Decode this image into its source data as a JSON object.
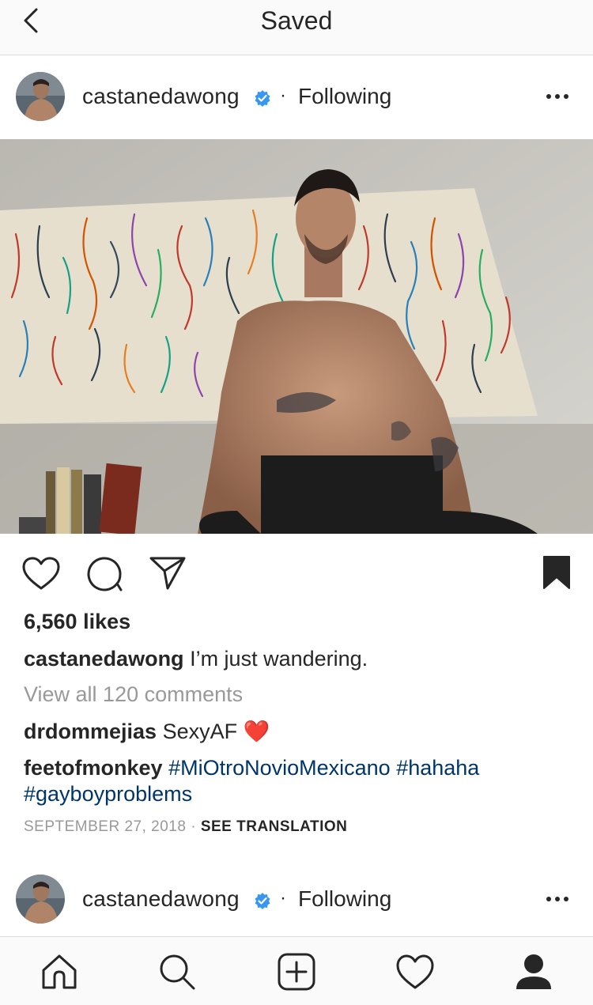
{
  "header": {
    "title": "Saved",
    "back_icon": "chevron-left-icon"
  },
  "post": {
    "username": "castanedawong",
    "verified": true,
    "follow_separator": "·",
    "follow_status": "Following",
    "likes": "6,560 likes",
    "caption": {
      "username": "castanedawong",
      "text": " I’m just wandering."
    },
    "view_comments": "View all 120 comments",
    "comments": [
      {
        "username": "drdommejias",
        "text": " SexyAF ",
        "emoji": "❤️"
      },
      {
        "username": "feetofmonkey",
        "hashtags": [
          "#MiOtroNovioMexicano",
          "#hahaha",
          "#gayboyproblems"
        ]
      }
    ],
    "date": "SEPTEMBER 27, 2018",
    "meta_separator": " · ",
    "see_translation": "SEE TRANSLATION",
    "actions": [
      "heart-icon",
      "comment-icon",
      "share-icon",
      "bookmark-icon"
    ]
  },
  "next_post": {
    "username": "castanedawong",
    "verified": true,
    "follow_separator": "·",
    "follow_status": "Following"
  },
  "bottom_nav": [
    "home-icon",
    "search-icon",
    "add-post-icon",
    "activity-heart-icon",
    "profile-icon"
  ],
  "colors": {
    "text": "#262626",
    "muted": "#999999",
    "hashtag": "#003569",
    "verified": "#3897f0",
    "heart_emoji": "#e0245e"
  }
}
